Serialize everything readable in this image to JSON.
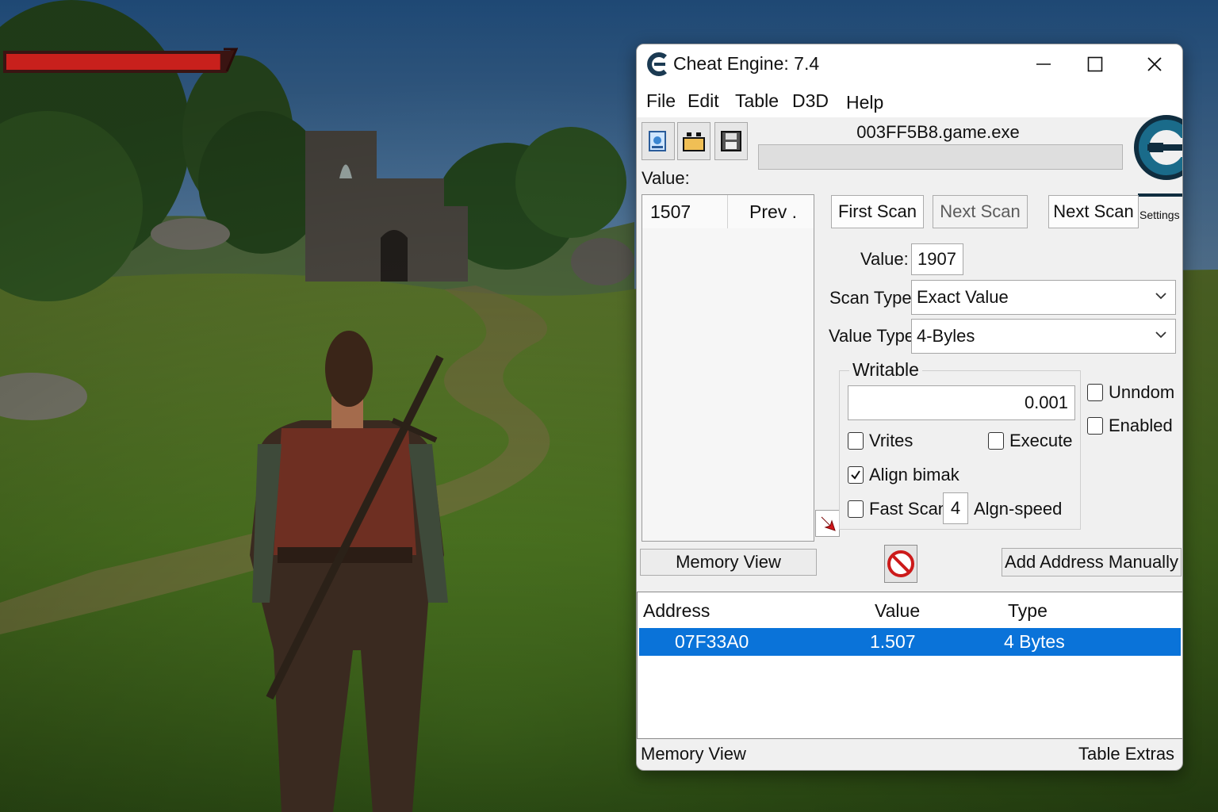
{
  "window": {
    "title": "Cheat Engine: 7.4",
    "controls": [
      "minimize-icon",
      "maximize-icon",
      "close-icon"
    ]
  },
  "menu": [
    "File",
    "Edit",
    "Table",
    "D3D",
    "Help"
  ],
  "toolbar": {
    "icons": [
      "process-list-icon",
      "open-table-icon",
      "save-table-icon"
    ],
    "process_name": "003FF5B8.game.exe",
    "settings_label": "Settings"
  },
  "scan": {
    "value_label": "Value:",
    "results_columns": [
      "1507",
      "Prev ."
    ],
    "first_scan": "First Scan",
    "next_scan_disabled": "Next Scan",
    "next_scan": "Next Scan",
    "value_field_label": "Value:",
    "value_field": "1907",
    "scan_type_label": "Scan Type:",
    "scan_type": "Exact Value",
    "value_type_label": "Value Type:",
    "value_type": "4-Byles"
  },
  "memory_options": {
    "title": "Writable",
    "value": "0.001",
    "writes": "Vrites",
    "execute": "Execute",
    "align": "Align bimak",
    "align_checked": true,
    "fast_scan": "Fast Scan",
    "align_speed_value": "4",
    "align_speed": "Algn-speed",
    "undo": "Unndom",
    "enabled": "Enabled"
  },
  "buttons": {
    "memory_view": "Memory View",
    "add_address": "Add Address Manually"
  },
  "address_list": {
    "columns": [
      "Address",
      "Value",
      "Type"
    ],
    "rows": [
      {
        "address": "07F33A0",
        "value": "1.507",
        "type": "4 Bytes",
        "selected": true
      }
    ]
  },
  "footer": {
    "left": "Memory View",
    "right": "Table Extras"
  },
  "game": {
    "health_fraction": 0.93,
    "health_color": "#c8201c"
  },
  "colors": {
    "selection": "#0a73d9",
    "ce_logo": "#1a6b8a"
  }
}
